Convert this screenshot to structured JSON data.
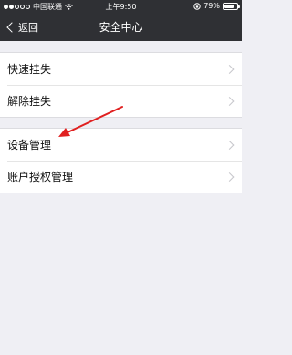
{
  "status_bar": {
    "signal_filled": 2,
    "signal_total": 5,
    "carrier": "中国联通",
    "wifi_icon": "wifi-icon",
    "time": "上午9:50",
    "lock_icon": "rotation-lock-icon",
    "battery_percent": "79%",
    "battery_level": 0.79
  },
  "nav": {
    "back_label": "返回",
    "title": "安全中心"
  },
  "groups": [
    {
      "items": [
        {
          "label": "快速挂失"
        },
        {
          "label": "解除挂失"
        }
      ]
    },
    {
      "items": [
        {
          "label": "设备管理"
        },
        {
          "label": "账户授权管理"
        }
      ]
    }
  ],
  "colors": {
    "bar_background": "#2f3034",
    "page_background": "#efeff4",
    "annotation_arrow": "#e02020"
  }
}
